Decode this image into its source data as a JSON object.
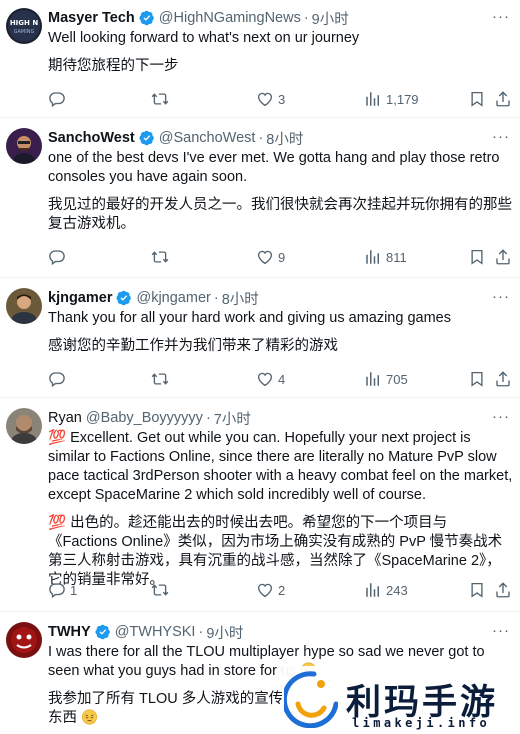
{
  "tweets": [
    {
      "name": "Masyer Tech",
      "verified": true,
      "handle": "@HighNGamingNews",
      "dot": "·",
      "time": "9小时",
      "text": "Well looking forward to what's next on ur journey",
      "translation": "期待您旅程的下一步",
      "stats": {
        "replies": "",
        "retweets": "",
        "likes": "3",
        "views": "1,179"
      }
    },
    {
      "name": "SanchoWest",
      "verified": true,
      "handle": "@SanchoWest",
      "dot": "·",
      "time": "8小时",
      "text": "one of the best devs I've ever met. We gotta hang and play those retro consoles you have again soon.",
      "translation": "我见过的最好的开发人员之一。我们很快就会再次挂起并玩你拥有的那些复古游戏机。",
      "stats": {
        "replies": "",
        "retweets": "",
        "likes": "9",
        "views": "811"
      }
    },
    {
      "name": "kjngamer",
      "verified": true,
      "handle": "@kjngamer",
      "dot": "·",
      "time": "8小时",
      "text": "Thank you for all your hard work and giving us amazing games",
      "translation": "感谢您的辛勤工作并为我们带来了精彩的游戏",
      "stats": {
        "replies": "",
        "retweets": "",
        "likes": "4",
        "views": "705"
      }
    },
    {
      "name": "Ryan",
      "verified": false,
      "handle": "@Baby_Boyyyyyy",
      "dot": "·",
      "time": "7小时",
      "text": "💯 Excellent. Get out while you can. Hopefully your next project is similar to Factions Online, since there are literally no Mature PvP slow pace tactical 3rdPerson shooter with a heavy combat feel on the market, except SpaceMarine 2 which sold incredibly well of course.",
      "translation": "💯 出色的。趁还能出去的时候出去吧。希望您的下一个项目与《Factions Online》类似，因为市场上确实没有成熟的 PvP 慢节奏战术第三人称射击游戏，具有沉重的战斗感，当然除了《SpaceMarine 2》，它的销量非常好。",
      "stats": {
        "replies": "1",
        "retweets": "",
        "likes": "2",
        "views": "243"
      }
    },
    {
      "name": "TWHY",
      "verified": true,
      "handle": "@TWHYSKI",
      "dot": "·",
      "time": "9小时",
      "text": "I was there for all the TLOU multiplayer hype so sad we never got to seen what you guys had in store for us",
      "translation_line1": "我参加了所有 TLOU 多人游戏的宣传，",
      "translation_line2": "东西",
      "emoji": "pensive-face-icon"
    }
  ],
  "watermark": {
    "brand_cn": "利玛手游",
    "brand_en": "limakeji.info"
  },
  "colors": {
    "text": "#0f1419",
    "secondary": "#536471",
    "verified": "#1d9bf0",
    "divider": "#eff3f4",
    "watermark_brand": "#0b1d3a"
  }
}
